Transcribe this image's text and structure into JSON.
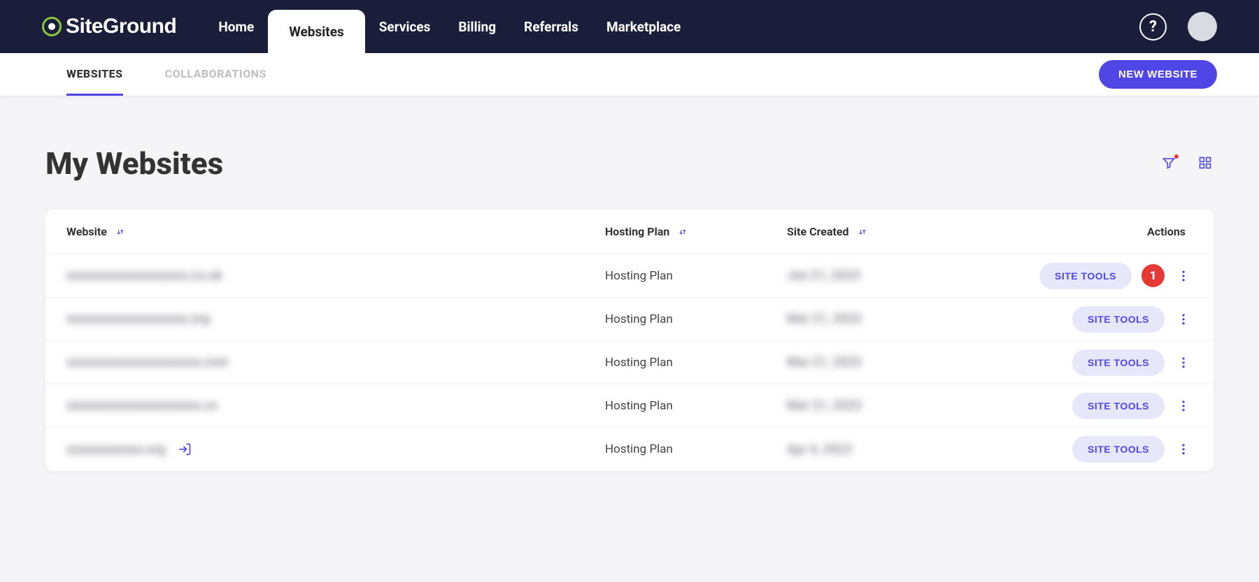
{
  "brand": "SiteGround",
  "nav": {
    "home": "Home",
    "websites": "Websites",
    "services": "Services",
    "billing": "Billing",
    "referrals": "Referrals",
    "marketplace": "Marketplace"
  },
  "help_label": "?",
  "subnav": {
    "websites": "WEBSITES",
    "collaborations": "COLLABORATIONS",
    "new_website": "NEW WEBSITE"
  },
  "page_title": "My Websites",
  "columns": {
    "website": "Website",
    "plan": "Hosting Plan",
    "created": "Site Created",
    "actions": "Actions"
  },
  "site_tools_label": "SITE TOOLS",
  "annotation_badge": "1",
  "rows": [
    {
      "domain": "xxxxxxxxxxxxxxxxxxx.co.uk",
      "plan": "Hosting Plan",
      "created": "Jan 21, 2023",
      "has_badge": true,
      "has_login": false
    },
    {
      "domain": "xxxxxxxxxxxxxxxxxxx.org",
      "plan": "Hosting Plan",
      "created": "Mar 21, 2023",
      "has_badge": false,
      "has_login": false
    },
    {
      "domain": "xxxxxxxxxxxxxxxxxxxxx.com",
      "plan": "Hosting Plan",
      "created": "Mar 21, 2023",
      "has_badge": false,
      "has_login": false
    },
    {
      "domain": "xxxxxxxxxxxxxxxxxxxxx.co",
      "plan": "Hosting Plan",
      "created": "Mar 21, 2023",
      "has_badge": false,
      "has_login": false
    },
    {
      "domain": "xxxxxxxxxxxx.org",
      "plan": "Hosting Plan",
      "created": "Apr 4, 2023",
      "has_badge": false,
      "has_login": true
    }
  ]
}
